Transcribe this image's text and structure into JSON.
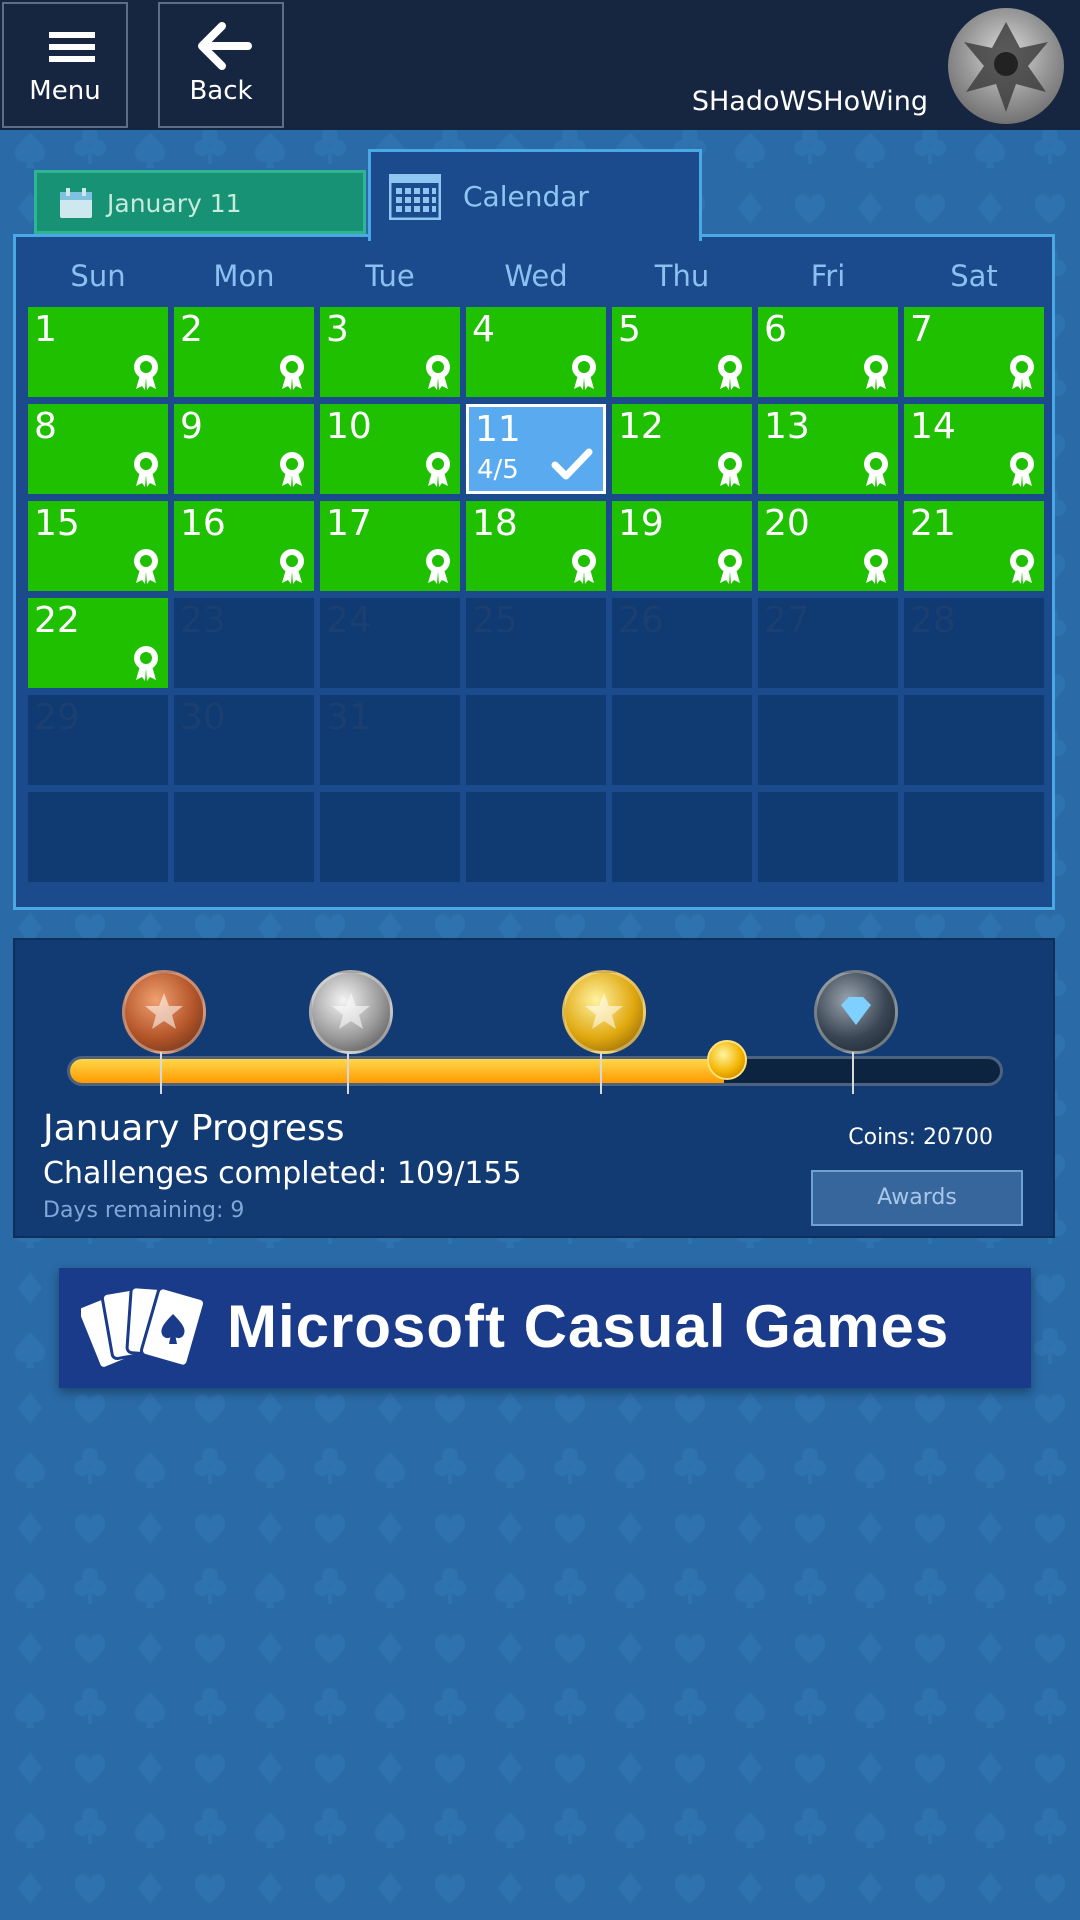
{
  "header": {
    "menu_label": "Menu",
    "back_label": "Back",
    "username": "SHadoWSHoWing"
  },
  "tabs": {
    "date_label": "January 11",
    "calendar_label": "Calendar"
  },
  "calendar": {
    "weekdays": [
      "Sun",
      "Mon",
      "Tue",
      "Wed",
      "Thu",
      "Fri",
      "Sat"
    ],
    "days": [
      {
        "label": "1",
        "state": "done"
      },
      {
        "label": "2",
        "state": "done"
      },
      {
        "label": "3",
        "state": "done"
      },
      {
        "label": "4",
        "state": "done"
      },
      {
        "label": "5",
        "state": "done"
      },
      {
        "label": "6",
        "state": "done"
      },
      {
        "label": "7",
        "state": "done"
      },
      {
        "label": "8",
        "state": "done"
      },
      {
        "label": "9",
        "state": "done"
      },
      {
        "label": "10",
        "state": "done"
      },
      {
        "label": "11",
        "state": "current",
        "progress": "4/5"
      },
      {
        "label": "12",
        "state": "done"
      },
      {
        "label": "13",
        "state": "done"
      },
      {
        "label": "14",
        "state": "done"
      },
      {
        "label": "15",
        "state": "done"
      },
      {
        "label": "16",
        "state": "done"
      },
      {
        "label": "17",
        "state": "done"
      },
      {
        "label": "18",
        "state": "done"
      },
      {
        "label": "19",
        "state": "done"
      },
      {
        "label": "20",
        "state": "done"
      },
      {
        "label": "21",
        "state": "done"
      },
      {
        "label": "22",
        "state": "done"
      },
      {
        "label": "23",
        "state": "future"
      },
      {
        "label": "24",
        "state": "future"
      },
      {
        "label": "25",
        "state": "future"
      },
      {
        "label": "26",
        "state": "future"
      },
      {
        "label": "27",
        "state": "future"
      },
      {
        "label": "28",
        "state": "future"
      },
      {
        "label": "29",
        "state": "future"
      },
      {
        "label": "30",
        "state": "future"
      },
      {
        "label": "31",
        "state": "future"
      },
      {
        "label": "",
        "state": "empty"
      },
      {
        "label": "",
        "state": "empty"
      },
      {
        "label": "",
        "state": "empty"
      },
      {
        "label": "",
        "state": "empty"
      },
      {
        "label": "",
        "state": "empty"
      },
      {
        "label": "",
        "state": "empty"
      },
      {
        "label": "",
        "state": "empty"
      },
      {
        "label": "",
        "state": "empty"
      },
      {
        "label": "",
        "state": "empty"
      },
      {
        "label": "",
        "state": "empty"
      },
      {
        "label": "",
        "state": "empty"
      }
    ]
  },
  "progress": {
    "title": "January Progress",
    "challenges": "Challenges completed: 109/155",
    "days_remaining": "Days remaining: 9",
    "coins": "Coins: 20700",
    "awards_label": "Awards",
    "fraction": 0.703,
    "milestones": [
      {
        "icon": "bronze-star-medal-icon",
        "at": 0.1
      },
      {
        "icon": "silver-stars-medal-icon",
        "at": 0.3
      },
      {
        "icon": "gold-stars-medal-icon",
        "at": 0.57
      },
      {
        "icon": "diamond-medal-icon",
        "at": 0.84
      }
    ]
  },
  "banner": {
    "brand": "Microsoft Casual Games"
  },
  "colors": {
    "completed_day": "#1ec000",
    "current_day": "#5aaaf0",
    "panel": "#1b4b8c",
    "background": "#2a6aa6"
  }
}
